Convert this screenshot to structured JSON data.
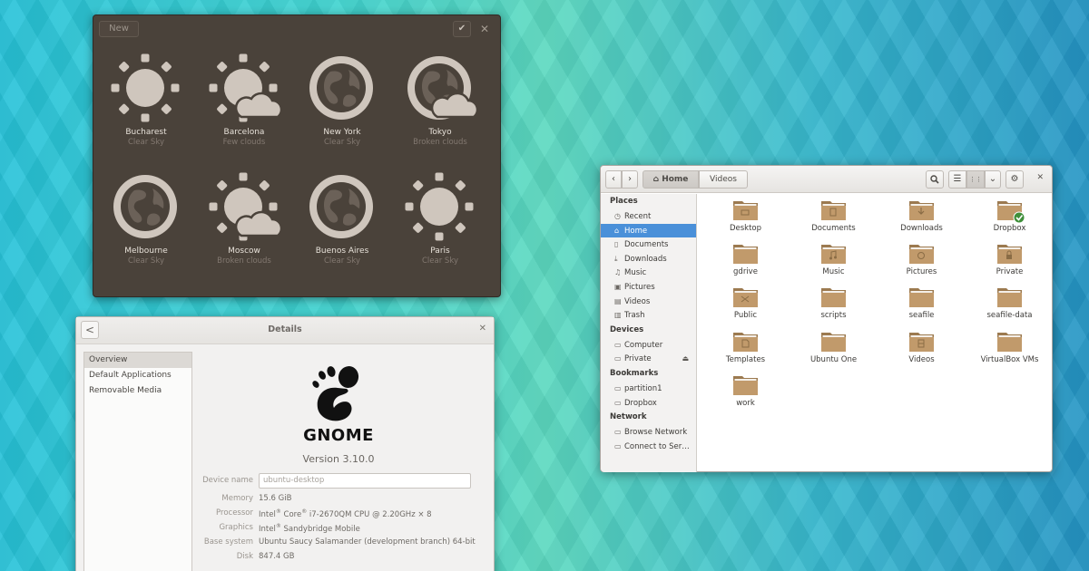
{
  "weather": {
    "new_label": "New",
    "ok_glyph": "✔",
    "close_glyph": "✕",
    "cities": [
      {
        "city": "Bucharest",
        "cond": "Clear Sky",
        "icon": "sun"
      },
      {
        "city": "Barcelona",
        "cond": "Few clouds",
        "icon": "sun-cloud"
      },
      {
        "city": "New York",
        "cond": "Clear Sky",
        "icon": "globe"
      },
      {
        "city": "Tokyo",
        "cond": "Broken clouds",
        "icon": "globe-cloud"
      },
      {
        "city": "Melbourne",
        "cond": "Clear Sky",
        "icon": "globe"
      },
      {
        "city": "Moscow",
        "cond": "Broken clouds",
        "icon": "sun-cloud"
      },
      {
        "city": "Buenos Aires",
        "cond": "Clear Sky",
        "icon": "globe"
      },
      {
        "city": "Paris",
        "cond": "Clear Sky",
        "icon": "sun"
      }
    ]
  },
  "details": {
    "back_glyph": "<",
    "title": "Details",
    "close_glyph": "✕",
    "sidebar": [
      "Overview",
      "Default Applications",
      "Removable Media"
    ],
    "logo_word": "GNOME",
    "version": "Version 3.10.0",
    "device_name_label": "Device name",
    "device_name_value": "ubuntu-desktop",
    "memory_label": "Memory",
    "memory_value": "15.6 GiB",
    "processor_label": "Processor",
    "processor_a": "Intel",
    "processor_b": " Core",
    "processor_c": " i7-2670QM CPU @ 2.20GHz × 8",
    "graphics_label": "Graphics",
    "graphics_a": "Intel",
    "graphics_b": " Sandybridge Mobile",
    "base_label": "Base system",
    "base_value": "Ubuntu Saucy Salamander (development branch) 64-bit",
    "disk_label": "Disk",
    "disk_value": "847.4 GB",
    "reg_mark": "®"
  },
  "files": {
    "toolbar": {
      "back_glyph": "‹",
      "forward_glyph": "›",
      "home_label": "Home",
      "videos_label": "Videos",
      "search_glyph": "🔍",
      "list_glyph": "☰",
      "grid_glyph": "⋮⋮",
      "chevron_glyph": "⌄",
      "gear_glyph": "⚙",
      "close_glyph": "✕"
    },
    "sidebar": {
      "places_header": "Places",
      "places": [
        {
          "label": "Recent",
          "icon": "clock-icon",
          "glyph": "◷"
        },
        {
          "label": "Home",
          "icon": "home-icon",
          "glyph": "⌂"
        },
        {
          "label": "Documents",
          "icon": "document-icon",
          "glyph": "▯"
        },
        {
          "label": "Downloads",
          "icon": "download-icon",
          "glyph": "⤓"
        },
        {
          "label": "Music",
          "icon": "music-icon",
          "glyph": "♫"
        },
        {
          "label": "Pictures",
          "icon": "pictures-icon",
          "glyph": "▣"
        },
        {
          "label": "Videos",
          "icon": "video-icon",
          "glyph": "▤"
        },
        {
          "label": "Trash",
          "icon": "trash-icon",
          "glyph": "▥"
        }
      ],
      "devices_header": "Devices",
      "devices": [
        {
          "label": "Computer",
          "icon": "computer-icon",
          "glyph": "▭"
        },
        {
          "label": "Private",
          "icon": "drive-icon",
          "glyph": "▭"
        }
      ],
      "eject_glyph": "⏏",
      "bookmarks_header": "Bookmarks",
      "bookmarks": [
        {
          "label": "partition1",
          "icon": "folder-icon",
          "glyph": "▭"
        },
        {
          "label": "Dropbox",
          "icon": "folder-icon",
          "glyph": "▭"
        }
      ],
      "network_header": "Network",
      "network": [
        {
          "label": "Browse Network",
          "icon": "network-icon",
          "glyph": "▭"
        },
        {
          "label": "Connect to Ser…",
          "icon": "server-icon",
          "glyph": "▭"
        }
      ]
    },
    "items": [
      {
        "label": "Desktop",
        "emblem": "desktop"
      },
      {
        "label": "Documents",
        "emblem": "document"
      },
      {
        "label": "Downloads",
        "emblem": "download"
      },
      {
        "label": "Dropbox",
        "emblem": "check"
      },
      {
        "label": "gdrive",
        "emblem": ""
      },
      {
        "label": "Music",
        "emblem": "music"
      },
      {
        "label": "Pictures",
        "emblem": "camera"
      },
      {
        "label": "Private",
        "emblem": "lock"
      },
      {
        "label": "Public",
        "emblem": "share"
      },
      {
        "label": "scripts",
        "emblem": ""
      },
      {
        "label": "seafile",
        "emblem": ""
      },
      {
        "label": "seafile-data",
        "emblem": ""
      },
      {
        "label": "Templates",
        "emblem": "template"
      },
      {
        "label": "Ubuntu One",
        "emblem": ""
      },
      {
        "label": "Videos",
        "emblem": "video"
      },
      {
        "label": "VirtualBox VMs",
        "emblem": ""
      },
      {
        "label": "work",
        "emblem": ""
      }
    ],
    "colors": {
      "folder": "#c19a6b",
      "folder_dark": "#9c7a50",
      "selected": "#4a90d9"
    }
  }
}
